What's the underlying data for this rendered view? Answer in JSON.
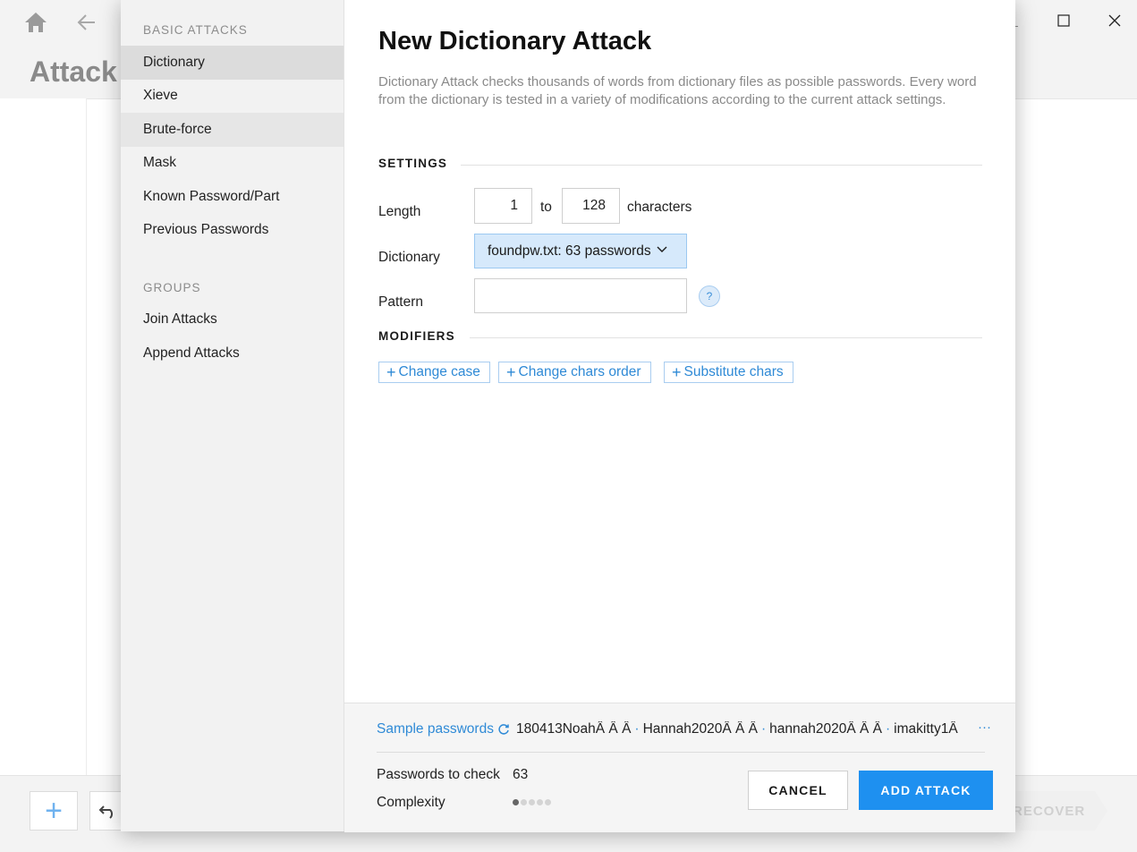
{
  "background": {
    "page_title": "Attack",
    "recover_label": "RECOVER"
  },
  "sidebar": {
    "basic_heading": "BASIC ATTACKS",
    "basic_items": [
      {
        "label": "Dictionary",
        "state": "selected"
      },
      {
        "label": "Xieve",
        "state": "normal"
      },
      {
        "label": "Brute-force",
        "state": "hover"
      },
      {
        "label": "Mask",
        "state": "normal"
      },
      {
        "label": "Known Password/Part",
        "state": "normal"
      },
      {
        "label": "Previous Passwords",
        "state": "normal"
      }
    ],
    "groups_heading": "GROUPS",
    "group_items": [
      {
        "label": "Join Attacks"
      },
      {
        "label": "Append Attacks"
      }
    ]
  },
  "dialog": {
    "title": "New Dictionary Attack",
    "description": "Dictionary Attack checks thousands of words from dictionary files as possible passwords. Every word from the dictionary is tested in a variety of modifications according to the current attack settings.",
    "settings_label": "SETTINGS",
    "length_label": "Length",
    "length_min": "1",
    "length_to": "to",
    "length_max": "128",
    "length_unit": "characters",
    "dictionary_label": "Dictionary",
    "dictionary_value": "foundpw.txt: 63 passwords",
    "pattern_label": "Pattern",
    "pattern_value": "",
    "help_label": "?",
    "modifiers_label": "MODIFIERS",
    "modifiers": [
      {
        "label": "Change case"
      },
      {
        "label": "Change chars order"
      },
      {
        "label": "Substitute chars"
      }
    ]
  },
  "footer": {
    "sample_label": "Sample passwords",
    "samples": [
      "180413NoahÂ Â Â",
      "Hannah2020Â Â Â",
      "hannah2020Â Â Â",
      "imakitty1Â"
    ],
    "more_label": "···",
    "passwords_label": "Passwords to check",
    "passwords_value": "63",
    "complexity_label": "Complexity",
    "complexity_level": 1,
    "complexity_max": 5,
    "cancel_label": "CANCEL",
    "add_label": "ADD ATTACK"
  },
  "colors": {
    "accent": "#1e90f0",
    "link": "#2f8ad6",
    "select_bg": "#d6e9fb"
  }
}
